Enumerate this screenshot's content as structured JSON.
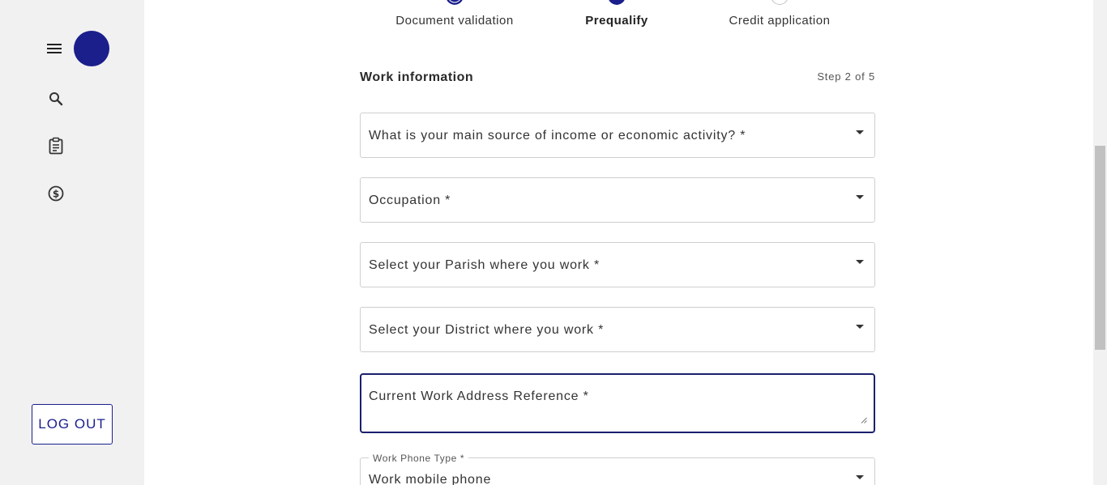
{
  "sidebar": {
    "icons": {
      "menu": "menu-icon",
      "search": "search-icon",
      "clipboard": "clipboard-icon",
      "dollar": "dollar-icon"
    },
    "logout_label": "LOG OUT",
    "accent_color": "#1a1f8c"
  },
  "stepper": {
    "steps": [
      {
        "label": "Document validation",
        "state": "completed"
      },
      {
        "label": "Prequalify",
        "state": "active"
      },
      {
        "label": "Credit application",
        "state": "pending"
      }
    ]
  },
  "form": {
    "section_title": "Work information",
    "step_count": "Step 2 of 5",
    "fields": [
      {
        "label": "What is your main source of income or economic activity? *",
        "type": "select"
      },
      {
        "label": "Occupation *",
        "type": "select"
      },
      {
        "label": "Select your Parish where you work *",
        "type": "select"
      },
      {
        "label": "Select your District where you work *",
        "type": "select"
      }
    ],
    "address": {
      "label": "Current Work Address Reference *",
      "type": "textarea"
    },
    "phone_type": {
      "legend": "Work Phone Type *",
      "value": "Work mobile phone",
      "type": "select"
    }
  }
}
